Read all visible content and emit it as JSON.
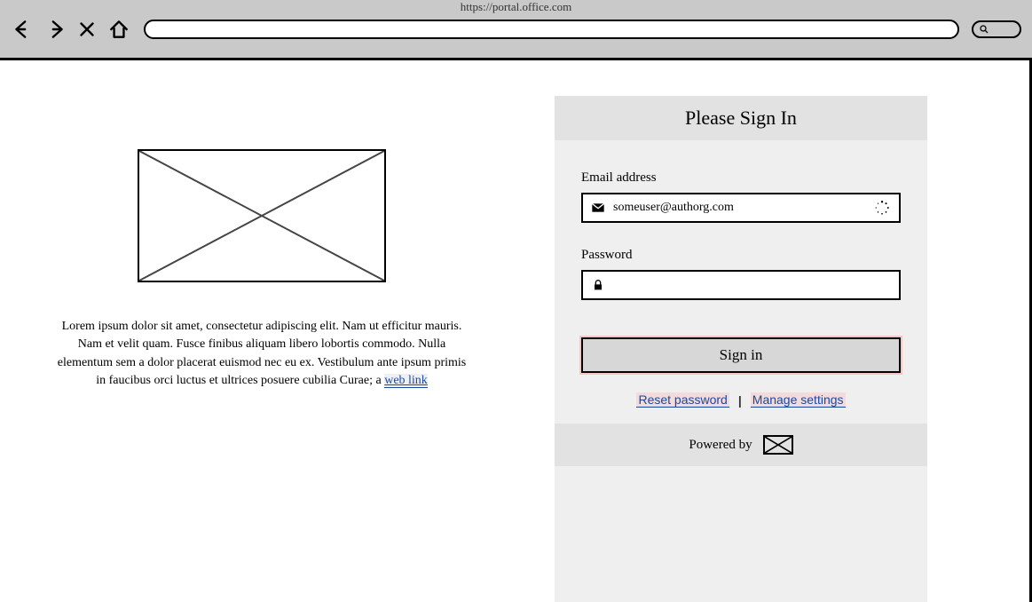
{
  "browser": {
    "url": "https://portal.office.com"
  },
  "left": {
    "lorem": "Lorem ipsum dolor sit amet, consectetur adipiscing elit. Nam ut efficitur mauris. Nam et velit quam. Fusce finibus aliquam libero lobortis commodo. Nulla elementum sem a dolor placerat euismod nec eu ex. Vestibulum ante ipsum primis in faucibus orci luctus et ultrices posuere cubilia Curae; a ",
    "weblink": "web link"
  },
  "panel": {
    "title": "Please Sign In",
    "email_label": "Email address",
    "email_value": "someuser@authorg.com",
    "password_label": "Password",
    "password_value": "",
    "signin_label": "Sign in",
    "reset_link": "Reset password",
    "manage_link": "Manage settings",
    "powered_by": "Powered by"
  }
}
